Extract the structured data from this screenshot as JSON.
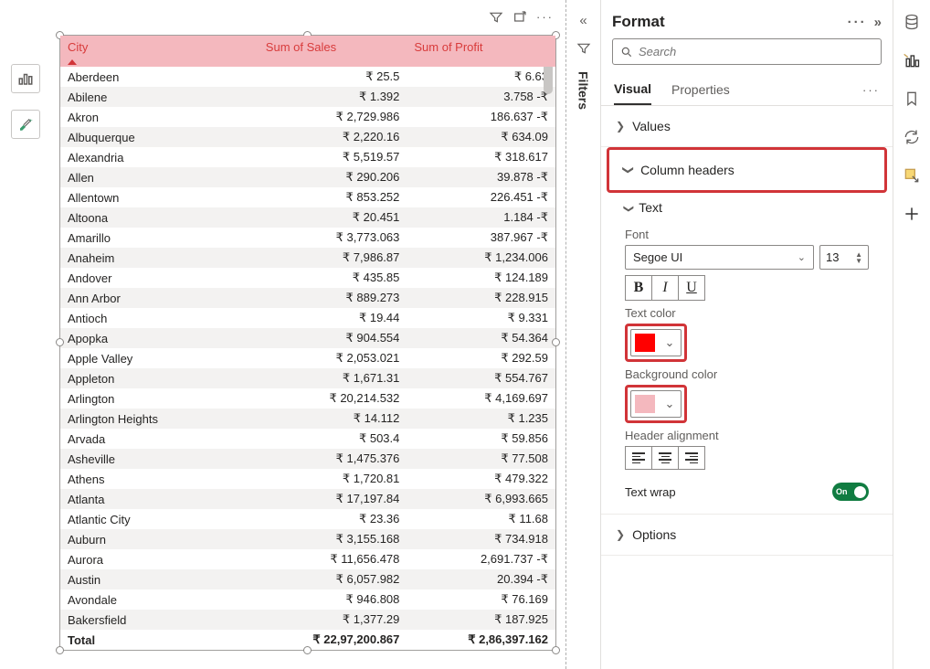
{
  "format": {
    "title": "Format",
    "search_placeholder": "Search",
    "tabs": {
      "visual": "Visual",
      "properties": "Properties"
    },
    "sections": {
      "values": "Values",
      "column_headers": "Column headers",
      "options": "Options"
    },
    "text_group": {
      "title": "Text",
      "font_label": "Font",
      "font_value": "Segoe UI",
      "font_size": "13",
      "text_color_label": "Text color",
      "text_color": "#ff0000",
      "bg_color_label": "Background color",
      "bg_color": "#f4b8be",
      "align_label": "Header alignment",
      "wrap_label": "Text wrap",
      "wrap_state": "On"
    }
  },
  "filters_label": "Filters",
  "table": {
    "headers": [
      "City",
      "Sum of Sales",
      "Sum of Profit"
    ],
    "rows": [
      [
        "Aberdeen",
        "₹ 25.5",
        "₹ 6.63"
      ],
      [
        "Abilene",
        "₹ 1.392",
        "3.758 -₹"
      ],
      [
        "Akron",
        "₹ 2,729.986",
        "186.637 -₹"
      ],
      [
        "Albuquerque",
        "₹ 2,220.16",
        "₹ 634.09"
      ],
      [
        "Alexandria",
        "₹ 5,519.57",
        "₹ 318.617"
      ],
      [
        "Allen",
        "₹ 290.206",
        "39.878 -₹"
      ],
      [
        "Allentown",
        "₹ 853.252",
        "226.451 -₹"
      ],
      [
        "Altoona",
        "₹ 20.451",
        "1.184 -₹"
      ],
      [
        "Amarillo",
        "₹ 3,773.063",
        "387.967 -₹"
      ],
      [
        "Anaheim",
        "₹ 7,986.87",
        "₹ 1,234.006"
      ],
      [
        "Andover",
        "₹ 435.85",
        "₹ 124.189"
      ],
      [
        "Ann Arbor",
        "₹ 889.273",
        "₹ 228.915"
      ],
      [
        "Antioch",
        "₹ 19.44",
        "₹ 9.331"
      ],
      [
        "Apopka",
        "₹ 904.554",
        "₹ 54.364"
      ],
      [
        "Apple Valley",
        "₹ 2,053.021",
        "₹ 292.59"
      ],
      [
        "Appleton",
        "₹ 1,671.31",
        "₹ 554.767"
      ],
      [
        "Arlington",
        "₹ 20,214.532",
        "₹ 4,169.697"
      ],
      [
        "Arlington Heights",
        "₹ 14.112",
        "₹ 1.235"
      ],
      [
        "Arvada",
        "₹ 503.4",
        "₹ 59.856"
      ],
      [
        "Asheville",
        "₹ 1,475.376",
        "₹ 77.508"
      ],
      [
        "Athens",
        "₹ 1,720.81",
        "₹ 479.322"
      ],
      [
        "Atlanta",
        "₹ 17,197.84",
        "₹ 6,993.665"
      ],
      [
        "Atlantic City",
        "₹ 23.36",
        "₹ 11.68"
      ],
      [
        "Auburn",
        "₹ 3,155.168",
        "₹ 734.918"
      ],
      [
        "Aurora",
        "₹ 11,656.478",
        "2,691.737 -₹"
      ],
      [
        "Austin",
        "₹ 6,057.982",
        "20.394 -₹"
      ],
      [
        "Avondale",
        "₹ 946.808",
        "₹ 76.169"
      ],
      [
        "Bakersfield",
        "₹ 1,377.29",
        "₹ 187.925"
      ]
    ],
    "total": [
      "Total",
      "₹ 22,97,200.867",
      "₹ 2,86,397.162"
    ]
  }
}
